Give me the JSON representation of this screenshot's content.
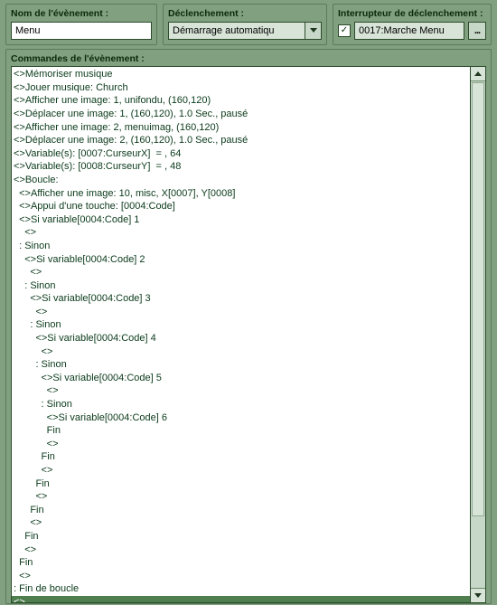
{
  "labels": {
    "event_name": "Nom de l'évènement :",
    "trigger": "Déclenchement :",
    "trigger_switch": "Interrupteur de déclenchement :",
    "commands": "Commandes de l'évènement :"
  },
  "fields": {
    "event_name_value": "Menu",
    "trigger_value": "Démarrage automatiqu",
    "switch_checked": true,
    "switch_value": "0017:Marche Menu",
    "ellipsis": "..."
  },
  "commands": [
    {
      "i": 0,
      "t": "<>Mémoriser musique"
    },
    {
      "i": 0,
      "t": "<>Jouer musique: Church"
    },
    {
      "i": 0,
      "t": "<>Afficher une image: 1, unifondu, (160,120)"
    },
    {
      "i": 0,
      "t": "<>Déplacer une image: 1, (160,120), 1.0 Sec., pausé"
    },
    {
      "i": 0,
      "t": "<>Afficher une image: 2, menuimag, (160,120)"
    },
    {
      "i": 0,
      "t": "<>Déplacer une image: 2, (160,120), 1.0 Sec., pausé"
    },
    {
      "i": 0,
      "t": "<>Variable(s): [0007:CurseurX]  = , 64"
    },
    {
      "i": 0,
      "t": "<>Variable(s): [0008:CurseurY]  = , 48"
    },
    {
      "i": 0,
      "t": "<>Boucle:"
    },
    {
      "i": 1,
      "t": "<>Afficher une image: 10, misc, X[0007], Y[0008]"
    },
    {
      "i": 1,
      "t": "<>Appui d'une touche: [0004:Code]"
    },
    {
      "i": 1,
      "t": "<>Si variable[0004:Code] 1"
    },
    {
      "i": 2,
      "t": "<>"
    },
    {
      "i": 1,
      "t": ": Sinon"
    },
    {
      "i": 2,
      "t": "<>Si variable[0004:Code] 2"
    },
    {
      "i": 3,
      "t": "<>"
    },
    {
      "i": 2,
      "t": ": Sinon"
    },
    {
      "i": 3,
      "t": "<>Si variable[0004:Code] 3"
    },
    {
      "i": 4,
      "t": "<>"
    },
    {
      "i": 3,
      "t": ": Sinon"
    },
    {
      "i": 4,
      "t": "<>Si variable[0004:Code] 4"
    },
    {
      "i": 5,
      "t": "<>"
    },
    {
      "i": 4,
      "t": ": Sinon"
    },
    {
      "i": 5,
      "t": "<>Si variable[0004:Code] 5"
    },
    {
      "i": 6,
      "t": "<>"
    },
    {
      "i": 5,
      "t": ": Sinon"
    },
    {
      "i": 6,
      "t": "<>Si variable[0004:Code] 6"
    },
    {
      "i": 6,
      "t": "Fin"
    },
    {
      "i": 6,
      "t": "<>"
    },
    {
      "i": 5,
      "t": "Fin"
    },
    {
      "i": 5,
      "t": "<>"
    },
    {
      "i": 4,
      "t": "Fin"
    },
    {
      "i": 4,
      "t": "<>"
    },
    {
      "i": 3,
      "t": "Fin"
    },
    {
      "i": 3,
      "t": "<>"
    },
    {
      "i": 2,
      "t": "Fin"
    },
    {
      "i": 2,
      "t": "<>"
    },
    {
      "i": 1,
      "t": "Fin"
    },
    {
      "i": 1,
      "t": "<>"
    },
    {
      "i": 0,
      "t": ": Fin de boucle"
    },
    {
      "i": 0,
      "t": "<>",
      "sel": true
    }
  ],
  "indent_unit": "  "
}
